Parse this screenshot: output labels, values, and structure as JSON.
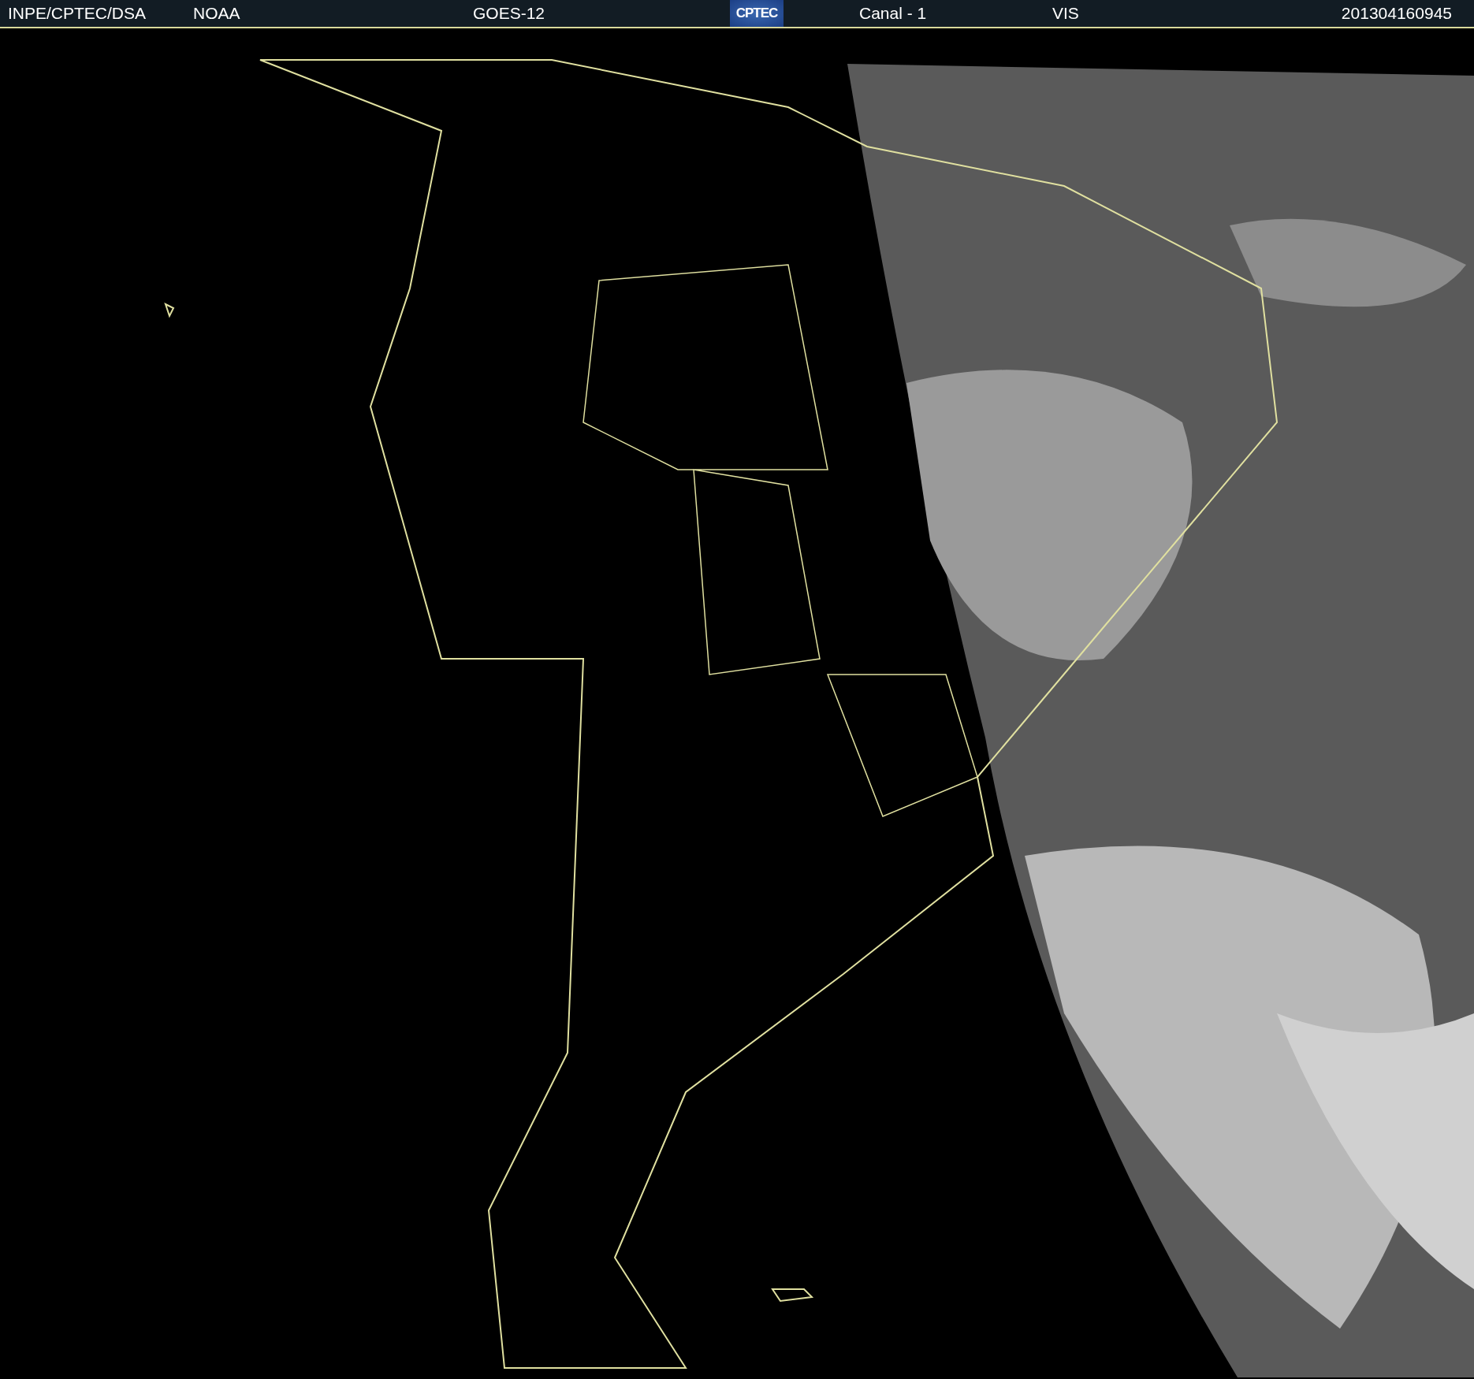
{
  "header": {
    "items": [
      {
        "kind": "text",
        "text": "INPE/CPTEC/DSA"
      },
      {
        "kind": "text",
        "text": "NOAA"
      },
      {
        "kind": "text",
        "text": "GOES-12"
      },
      {
        "kind": "logo",
        "text": "CPTEC"
      },
      {
        "kind": "text",
        "text": "Canal - 1"
      },
      {
        "kind": "text",
        "text": "VIS"
      },
      {
        "kind": "text",
        "text": "201304160945"
      }
    ]
  }
}
